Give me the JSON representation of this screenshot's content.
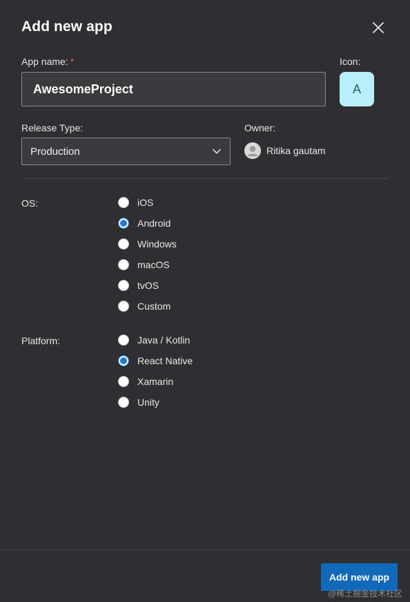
{
  "dialog": {
    "title": "Add new app",
    "close_icon": "close-icon"
  },
  "app_name": {
    "label": "App name:",
    "required_mark": "*",
    "value": "AwesomeProject"
  },
  "icon": {
    "label": "Icon:",
    "letter": "A",
    "background": "#b7f0fb"
  },
  "release_type": {
    "label": "Release Type:",
    "selected": "Production",
    "dropdown_icon": "chevron-down-icon"
  },
  "owner": {
    "label": "Owner:",
    "name": "Ritika gautam",
    "avatar_icon": "user-avatar-icon"
  },
  "os": {
    "label": "OS:",
    "options": [
      {
        "label": "iOS",
        "selected": false
      },
      {
        "label": "Android",
        "selected": true
      },
      {
        "label": "Windows",
        "selected": false
      },
      {
        "label": "macOS",
        "selected": false
      },
      {
        "label": "tvOS",
        "selected": false
      },
      {
        "label": "Custom",
        "selected": false
      }
    ]
  },
  "platform": {
    "label": "Platform:",
    "options": [
      {
        "label": "Java / Kotlin",
        "selected": false
      },
      {
        "label": "React Native",
        "selected": true
      },
      {
        "label": "Xamarin",
        "selected": false
      },
      {
        "label": "Unity",
        "selected": false
      }
    ]
  },
  "footer": {
    "submit_label": "Add new app"
  },
  "watermark": "@稀土掘金技术社区",
  "colors": {
    "background": "#2f2f31",
    "accent": "#1167b9",
    "radio_selected": "#1f7ad8",
    "required": "#e0565b"
  }
}
